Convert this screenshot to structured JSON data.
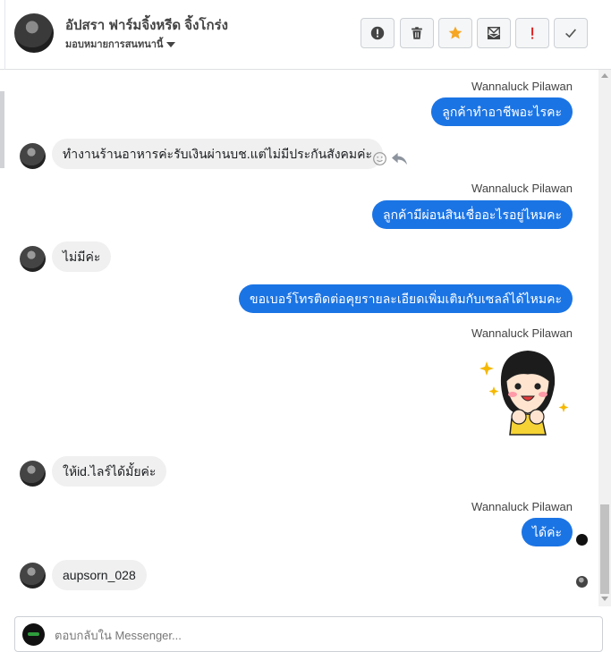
{
  "header": {
    "contact_name": "อัปสรา ฟาร์มจิ้งหรีด จิ้งโกร่ง",
    "assign_label": "มอบหมายการสนทนานี้",
    "actions": [
      {
        "name": "report-button",
        "icon": "exclamation-circle-icon"
      },
      {
        "name": "delete-button",
        "icon": "trash-icon"
      },
      {
        "name": "star-button",
        "icon": "star-icon",
        "color": "#f5a623"
      },
      {
        "name": "mark-unread-button",
        "icon": "envelope-icon"
      },
      {
        "name": "spam-button",
        "icon": "exclamation-icon",
        "color": "#e02020"
      },
      {
        "name": "done-button",
        "icon": "check-icon"
      }
    ]
  },
  "messages": {
    "m1": {
      "sender": "Wannaluck Pilawan",
      "text": "ลูกค้าทำอาชีพอะไรคะ"
    },
    "m2": {
      "text": "ทำงานร้านอาหารค่ะรับเงินผ่านบช.แต่ไม่มีประกันสังคมค่ะ"
    },
    "m3": {
      "sender": "Wannaluck Pilawan",
      "text": "ลูกค้ามีผ่อนสินเชื่ออะไรอยู่ไหมคะ"
    },
    "m4": {
      "text": "ไม่มีค่ะ"
    },
    "m5": {
      "text": "ขอเบอร์โทรติดต่อคุยรายละเอียดเพิ่มเติมกับเซลล์ได้ไหมคะ"
    },
    "m6": {
      "sender": "Wannaluck Pilawan",
      "sticker": "cartoon-girl-sticker"
    },
    "m7": {
      "text": "ให้id.ไลร์ได้มั้ยค่ะ"
    },
    "m8": {
      "sender": "Wannaluck Pilawan",
      "text": "ได้ค่ะ"
    },
    "m9": {
      "text": "aupsorn_028"
    }
  },
  "composer": {
    "placeholder": "ตอบกลับใน Messenger..."
  },
  "colors": {
    "outgoing_bubble": "#1b74e4",
    "incoming_bubble": "#f0f0f0"
  }
}
